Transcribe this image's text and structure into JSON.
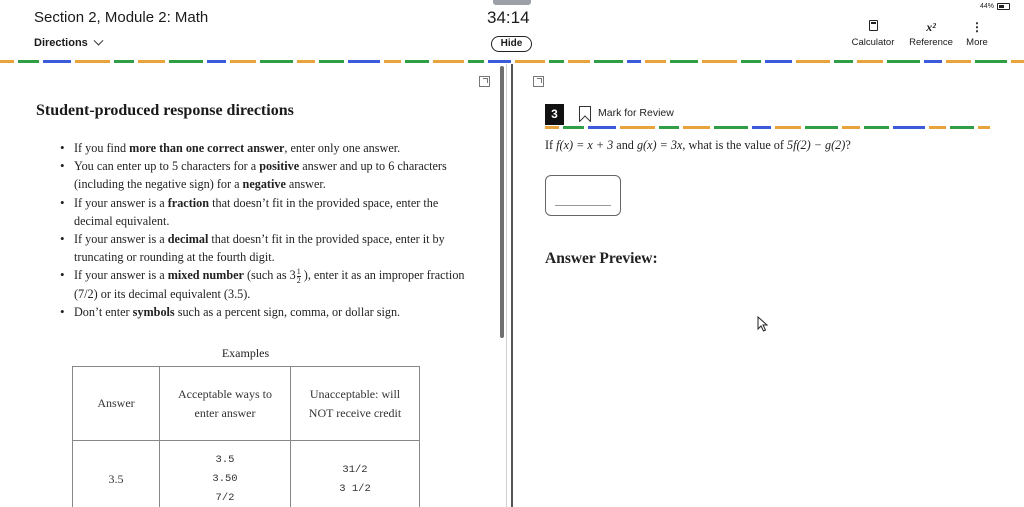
{
  "header": {
    "section_title": "Section 2, Module 2: Math",
    "directions_label": "Directions",
    "timer": "34:14",
    "hide_label": "Hide",
    "battery": "44%",
    "tools": [
      {
        "label": "Calculator",
        "icon": "calculator-icon"
      },
      {
        "label": "Reference",
        "icon": "reference-icon"
      },
      {
        "label": "More",
        "icon": "more-icon"
      }
    ],
    "reference_glyph": "x²",
    "more_glyph": "⋮"
  },
  "stripe_colors": [
    "#e8a33d",
    "#2f9e44",
    "#3b5bdb",
    "#e8a33d",
    "#2f9e44"
  ],
  "directions": {
    "title": "Student-produced response directions",
    "bullets": [
      {
        "pre": "If you find ",
        "bold": "more than one correct answer",
        "post": ", enter only one answer."
      },
      {
        "pre": "You can enter up to 5 characters for a ",
        "bold": "positive",
        "mid": " answer and up to 6 characters (including the negative sign) for a ",
        "bold2": "negative",
        "post": " answer."
      },
      {
        "pre": "If your answer is a ",
        "bold": "fraction",
        "post": " that doesn’t fit in the provided space, enter the decimal equivalent."
      },
      {
        "pre": "If your answer is a ",
        "bold": "decimal",
        "post": " that doesn’t fit in the provided space, enter it by truncating or rounding at the fourth digit."
      },
      {
        "pre": "If your answer is a ",
        "bold": "mixed number",
        "mid": " (such as 3",
        "frac_num": "1",
        "frac_den": "2",
        "post": " ), enter it as an improper fraction (7/2) or its decimal equivalent (3.5)."
      },
      {
        "pre": "Don’t enter ",
        "bold": "symbols",
        "post": " such as a percent sign, comma, or dollar sign."
      }
    ],
    "examples_caption": "Examples",
    "table": {
      "headers": [
        "Answer",
        "Acceptable ways to enter answer",
        "Unacceptable: will NOT receive credit"
      ],
      "rows": [
        {
          "answer": "3.5",
          "acceptable": [
            "3.5",
            "3.50",
            "7/2"
          ],
          "unacceptable": [
            "31/2",
            "3 1/2"
          ]
        }
      ]
    }
  },
  "question": {
    "number": "3",
    "mark_label": "Mark for Review",
    "text_parts": {
      "p1": "If ",
      "f": "f(x) = x + 3",
      "p2": " and ",
      "g": "g(x) = 3x",
      "p3": ", what is the value of ",
      "expr": "5f(2) − g(2)",
      "p4": "?"
    },
    "answer_value": "",
    "answer_preview_label": "Answer Preview:"
  }
}
